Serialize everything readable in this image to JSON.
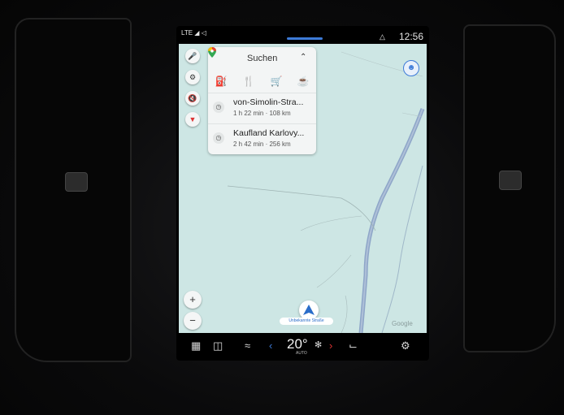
{
  "status": {
    "signal": "LTE ◢ ◁",
    "time": "12:56"
  },
  "maps": {
    "search_label": "Suchen",
    "categories": [
      "gas-station",
      "restaurant",
      "shopping",
      "cafe"
    ],
    "destinations": [
      {
        "name": "von-Simolin-Stra...",
        "meta": "1 h 22 min · 108 km"
      },
      {
        "name": "Kaufland Karlovy...",
        "meta": "2 h 42 min · 256 km"
      }
    ],
    "street_label": "Unbekannte Straße",
    "attribution": "Google",
    "zoom_in": "+",
    "zoom_out": "−"
  },
  "climate": {
    "temperature": "20°",
    "fan_label": "AUTO"
  },
  "colors": {
    "accent": "#3d7bd8",
    "map_water": "#cde6e4",
    "road": "#8ea6c8"
  }
}
